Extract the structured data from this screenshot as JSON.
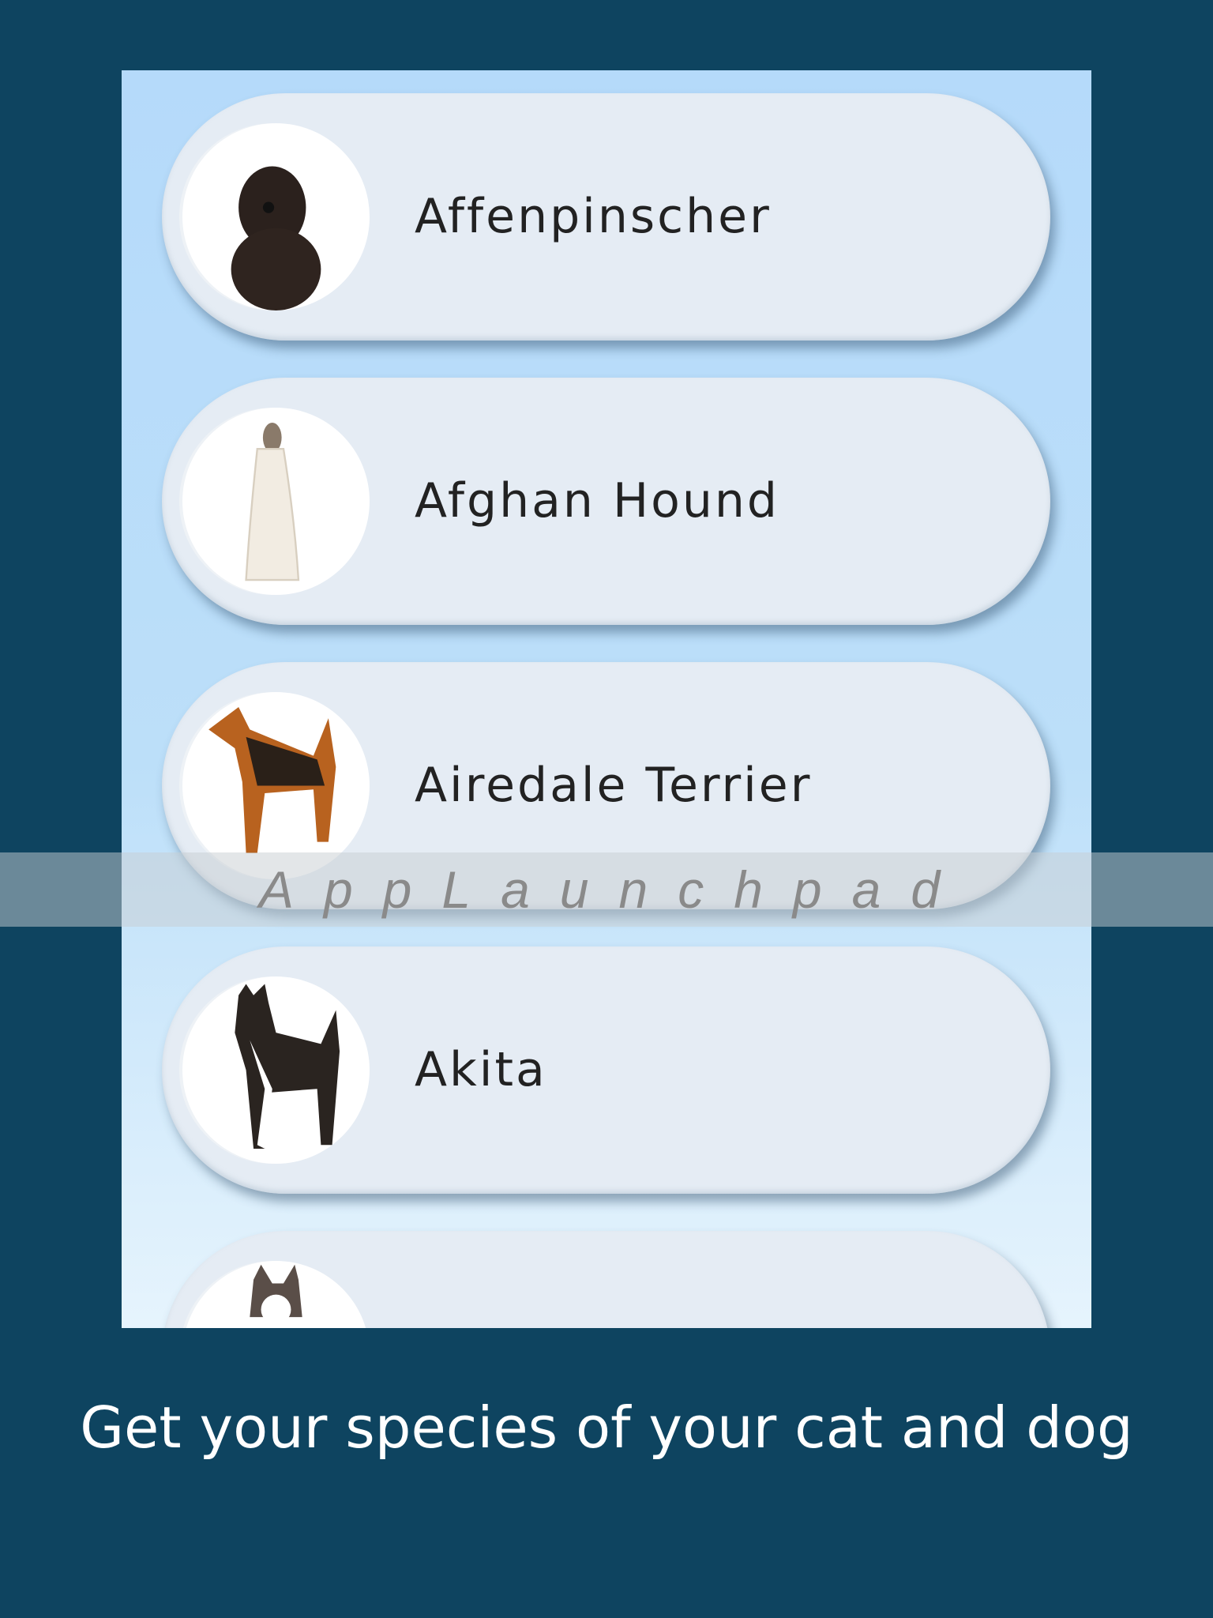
{
  "breeds": [
    {
      "name": "Affenpinscher",
      "icon": "dog-affenpinscher-photo"
    },
    {
      "name": "Afghan Hound",
      "icon": "dog-afghan-hound-photo"
    },
    {
      "name": "Airedale Terrier",
      "icon": "dog-airedale-terrier-photo"
    },
    {
      "name": "Akita",
      "icon": "dog-akita-photo"
    },
    {
      "name": "",
      "icon": "dog-husky-photo"
    }
  ],
  "watermark": "AppLaunchpad",
  "caption": "Get your species of your cat and dog",
  "colors": {
    "background": "#0e4460",
    "pill": "#e5ecf4",
    "text": "#222222"
  }
}
